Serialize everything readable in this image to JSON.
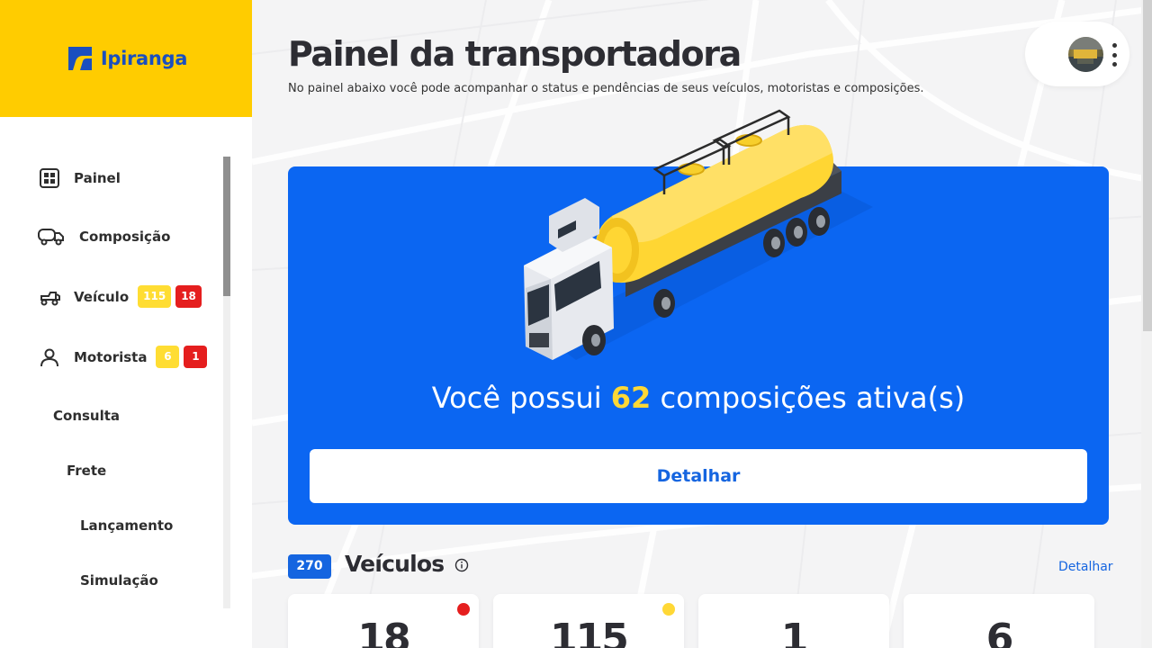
{
  "brand": {
    "name": "Ipiranga"
  },
  "sidebar": {
    "items": [
      {
        "label": "Painel",
        "icon": "dashboard-grid-icon"
      },
      {
        "label": "Composição",
        "icon": "truck-composition-icon"
      },
      {
        "label": "Veículo",
        "icon": "vehicle-icon",
        "badge_warning": "115",
        "badge_alert": "18"
      },
      {
        "label": "Motorista",
        "icon": "person-icon",
        "badge_warning": "6",
        "badge_alert": "1"
      }
    ],
    "sub_items": [
      {
        "label": "Consulta"
      },
      {
        "label": "Frete"
      },
      {
        "label": "Lançamento"
      },
      {
        "label": "Simulação"
      }
    ]
  },
  "header": {
    "title": "Painel da transportadora",
    "subtitle": "No painel abaixo você pode acompanhar o status e pendências de seus veículos, motoristas e composições."
  },
  "hero": {
    "text_before": "Você possui",
    "count": "62",
    "text_after": "composições ativa(s)",
    "button_label": "Detalhar"
  },
  "vehicles": {
    "count": "270",
    "title": "Veículos",
    "link_label": "Detalhar",
    "stats": [
      {
        "value": "18",
        "status_color": "#e51e1e"
      },
      {
        "value": "115",
        "status_color": "#ffd836"
      },
      {
        "value": "1",
        "status_color": ""
      },
      {
        "value": "6",
        "status_color": ""
      }
    ]
  },
  "colors": {
    "brand_yellow": "#ffcc00",
    "brand_blue": "#0b66f2",
    "alert_red": "#e51e1e",
    "warning_yellow": "#ffd836"
  }
}
